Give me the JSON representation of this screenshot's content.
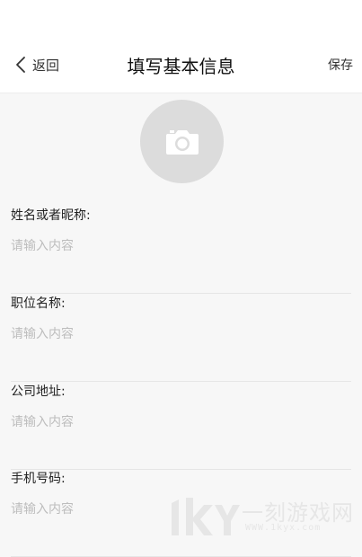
{
  "header": {
    "back_label": "返回",
    "title": "填写基本信息",
    "save_label": "保存"
  },
  "avatar": {
    "icon": "camera-icon"
  },
  "form": {
    "fields": [
      {
        "label": "姓名或者昵称:",
        "placeholder": "请输入内容",
        "value": ""
      },
      {
        "label": "职位名称:",
        "placeholder": "请输入内容",
        "value": ""
      },
      {
        "label": "公司地址:",
        "placeholder": "请输入内容",
        "value": ""
      },
      {
        "label": "手机号码:",
        "placeholder": "请输入内容",
        "value": ""
      }
    ]
  },
  "watermark": {
    "main": "一刻游戏网",
    "sub": "WWW.1kyx.com"
  },
  "colors": {
    "avatar_bg": "#dcdcdc",
    "placeholder": "#bdbdbd",
    "divider": "#e6e6e6",
    "background": "#f7f7f7"
  }
}
